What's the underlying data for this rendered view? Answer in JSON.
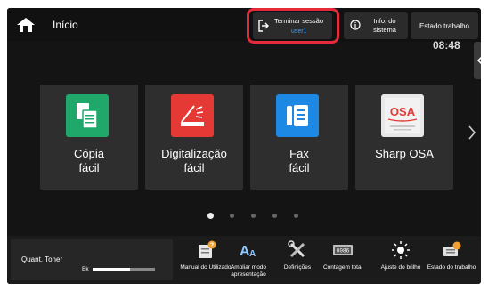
{
  "topbar": {
    "home_label": "Início",
    "logout": {
      "label": "Terminar sessão",
      "user": "user1"
    },
    "info": {
      "label": "Info. do sistema"
    },
    "status": {
      "label": "Estado trabalho"
    },
    "time": "08:48"
  },
  "apps": [
    {
      "line1": "Cópia",
      "line2": "fácil",
      "icon": "copy-icon",
      "color": "#1fa86a"
    },
    {
      "line1": "Digitalização",
      "line2": "fácil",
      "icon": "scan-icon",
      "color": "#e53935"
    },
    {
      "line1": "Fax",
      "line2": "fácil",
      "icon": "fax-icon",
      "color": "#1e88e5"
    },
    {
      "line1": "Sharp OSA",
      "line2": "",
      "icon": "sharp-osa-icon",
      "color": "#e0e0e0"
    }
  ],
  "pagination": {
    "pages": 5,
    "current": 1
  },
  "bottombar": {
    "toner": {
      "label": "Quant. Toner",
      "color_label": "Bk",
      "level": 0.6
    },
    "items": [
      {
        "label": "Manual do Utilizador",
        "icon": "manual-icon"
      },
      {
        "label": "Ampliar modo apresentação",
        "icon": "text-size-icon"
      },
      {
        "label": "Definições",
        "icon": "settings-tools-icon"
      },
      {
        "label": "Contagem total",
        "icon": "counter-icon"
      },
      {
        "label": "Ajuste do brilho",
        "icon": "brightness-icon"
      },
      {
        "label": "Estado do trabalho",
        "icon": "job-status-icon"
      }
    ]
  },
  "colors": {
    "accent": "#39a0ff",
    "highlight": "#e52a3a",
    "background": "#141414"
  }
}
